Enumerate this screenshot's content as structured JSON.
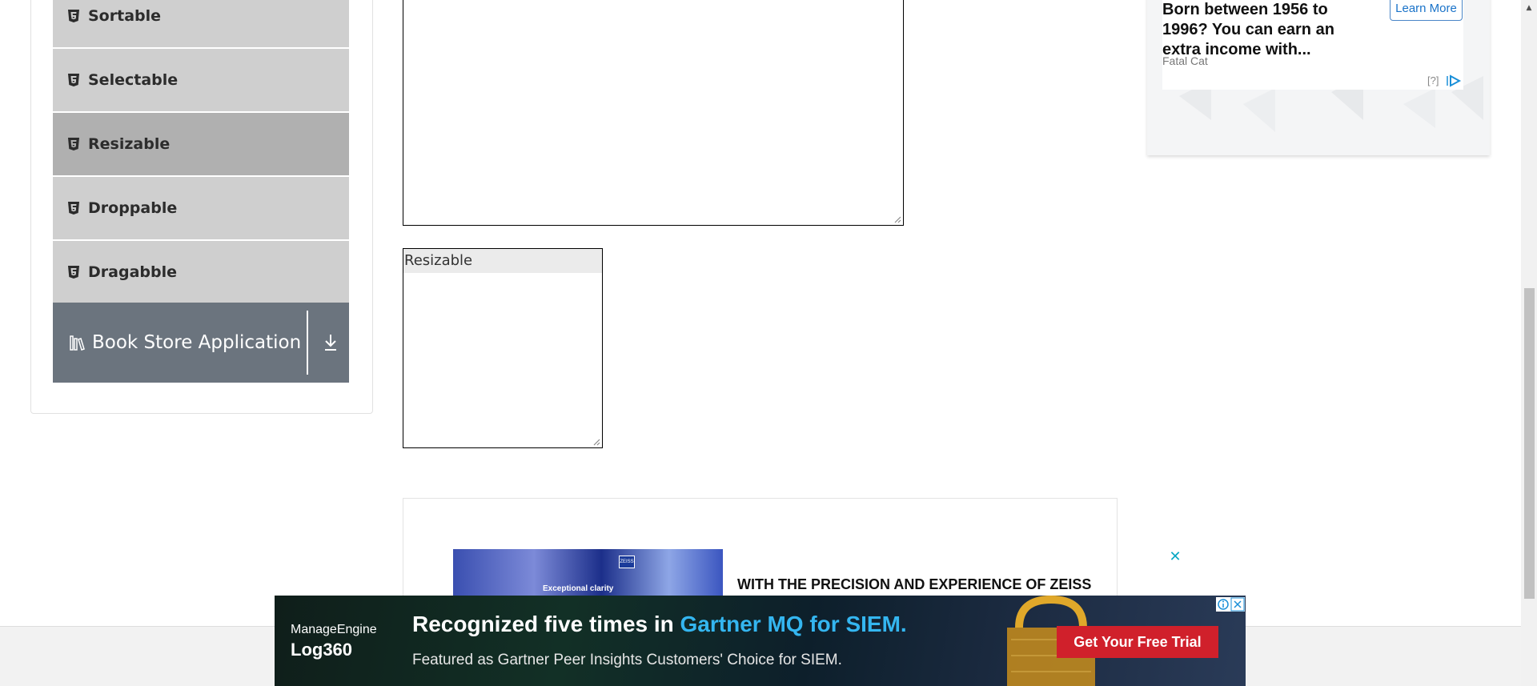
{
  "sidebar": {
    "items": [
      {
        "label": "Sortable",
        "active": false
      },
      {
        "label": "Selectable",
        "active": false
      },
      {
        "label": "Resizable",
        "active": true
      },
      {
        "label": "Droppable",
        "active": false
      },
      {
        "label": "Dragabble",
        "active": false
      }
    ],
    "bookstore": {
      "label": "Book Store Application"
    }
  },
  "main": {
    "resizable_box_label": "Resizable"
  },
  "ad_top": {
    "headline": "Born between 1956 to 1996? You can earn an extra income with...",
    "source": "Fatal Cat",
    "cta": "Learn More",
    "help": "[?]"
  },
  "ad_zeiss": {
    "caption": "Exceptional clarity",
    "logo": "ZEISS",
    "headline": "WITH THE PRECISION AND EXPERIENCE OF ZEISS",
    "close": "✕"
  },
  "ad_banner": {
    "brand_line1": "ManageEngine",
    "brand_line2": "Log360",
    "headline_plain": "Recognized five times in ",
    "headline_highlight": "Gartner MQ for SIEM.",
    "subline": "Featured as Gartner Peer Insights Customers' Choice for SIEM.",
    "cta": "Get Your Free Trial"
  },
  "colors": {
    "menu_bg": "#cfcfcf",
    "menu_active_bg": "#b0b0b0",
    "bookstore_bg": "#6b747e",
    "banner_highlight": "#34b6f0",
    "cta_red": "#d0202b"
  }
}
